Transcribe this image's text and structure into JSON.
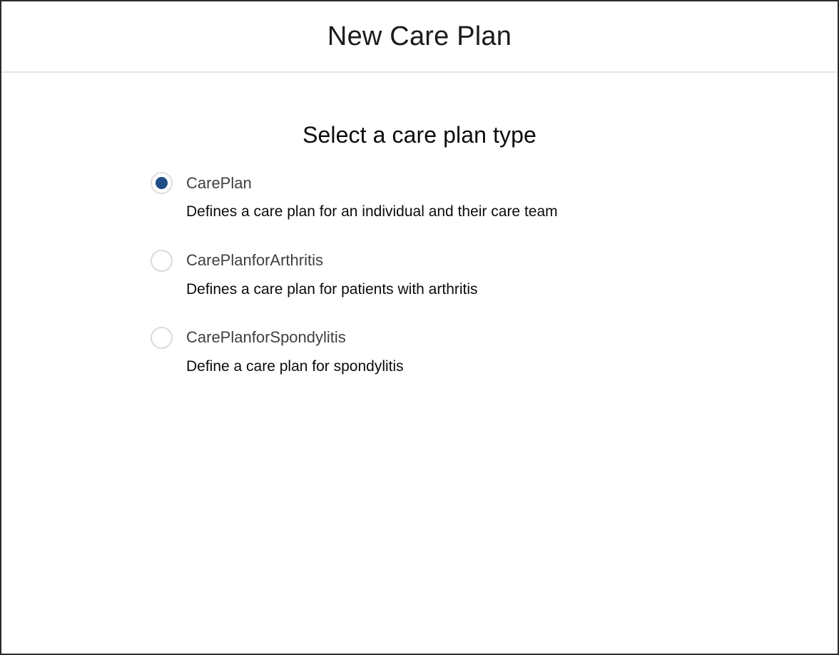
{
  "modal": {
    "title": "New Care Plan"
  },
  "main": {
    "heading": "Select a care plan type",
    "options": [
      {
        "label": "CarePlan",
        "description": "Defines a care plan for an individual and their care team",
        "selected": true
      },
      {
        "label": "CarePlanforArthritis",
        "description": "Defines a care plan for patients with arthritis",
        "selected": false
      },
      {
        "label": "CarePlanforSpondylitis",
        "description": "Define a care plan for spondylitis",
        "selected": false
      }
    ]
  },
  "colors": {
    "radio_selected_fill": "#1f4e85",
    "radio_border": "#dcdbda",
    "label_text": "#41403e",
    "description_text": "#0b0b0b",
    "title_text": "#1b1b1b",
    "divider": "#e5e5e5",
    "window_border": "#2b2b2b",
    "background": "#ffffff"
  }
}
